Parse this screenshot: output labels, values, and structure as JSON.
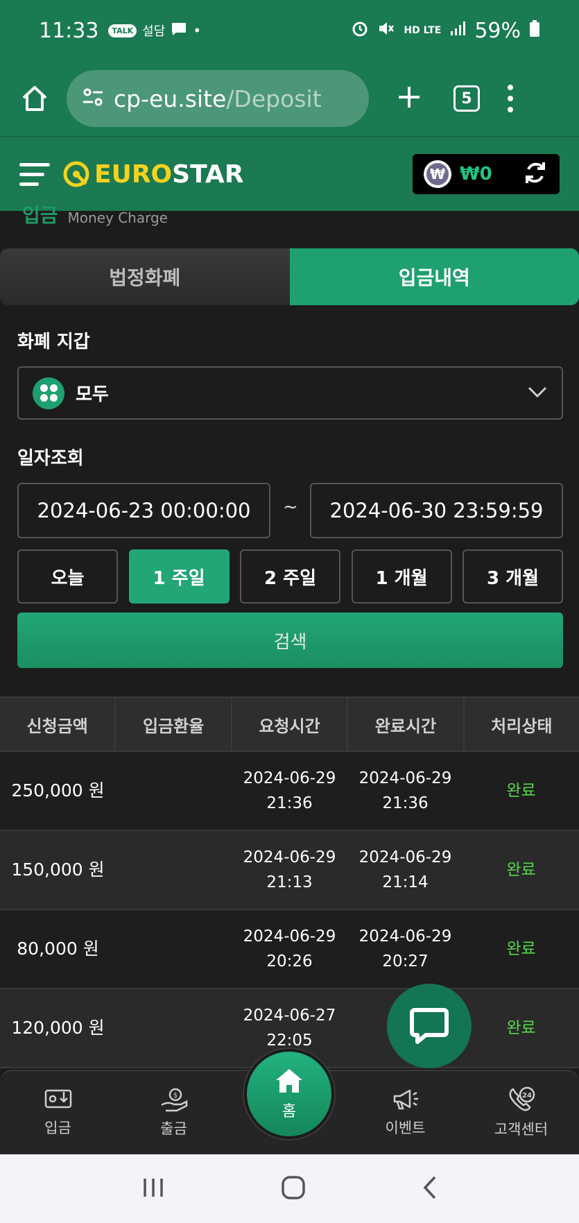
{
  "status_bar": {
    "time": "11:33",
    "notif_talk": "TALK",
    "notif_text": "설담",
    "signal": "HD LTE",
    "battery": "59%"
  },
  "browser": {
    "url_host": "cp-eu.site",
    "url_path": "/Deposit",
    "tab_count": "5"
  },
  "header": {
    "logo_euro": "EURO",
    "logo_star": "STAR",
    "wallet_symbol": "₩",
    "wallet_amount": "₩0"
  },
  "page": {
    "title_ko": "입금",
    "title_en": "Money Charge"
  },
  "tabs": [
    {
      "label": "법정화폐",
      "active": false
    },
    {
      "label": "입금내역",
      "active": true
    }
  ],
  "filters": {
    "wallet_label": "화폐 지갑",
    "wallet_value": "모두",
    "date_label": "일자조회",
    "date_from": "2024-06-23 00:00:00",
    "date_sep": "~",
    "date_to": "2024-06-30 23:59:59",
    "periods": [
      "오늘",
      "1 주일",
      "2 주일",
      "1 개월",
      "3 개월"
    ],
    "active_period": "1 주일",
    "search_label": "검색"
  },
  "table": {
    "headers": [
      "신청금액",
      "입금환율",
      "요청시간",
      "완료시간",
      "처리상태"
    ],
    "rows": [
      {
        "amount": "250,000 원",
        "rate": "",
        "req_date": "2024-06-29",
        "req_time": "21:36",
        "done_date": "2024-06-29",
        "done_time": "21:36",
        "status": "완료"
      },
      {
        "amount": "150,000 원",
        "rate": "",
        "req_date": "2024-06-29",
        "req_time": "21:13",
        "done_date": "2024-06-29",
        "done_time": "21:14",
        "status": "완료"
      },
      {
        "amount": "80,000 원",
        "rate": "",
        "req_date": "2024-06-29",
        "req_time": "20:26",
        "done_date": "2024-06-29",
        "done_time": "20:27",
        "status": "완료"
      },
      {
        "amount": "120,000 원",
        "rate": "",
        "req_date": "2024-06-27",
        "req_time": "22:05",
        "done_date": "202",
        "done_time": "2",
        "status": "완료"
      }
    ]
  },
  "bottom_nav": {
    "deposit": "입금",
    "withdraw": "출금",
    "home": "홈",
    "event": "이벤트",
    "support": "고객센터",
    "support_badge": "24"
  },
  "colors": {
    "brand_green": "#1a7a52",
    "accent_green": "#1fa071",
    "logo_yellow": "#f5d21c",
    "status_complete": "#56d64a"
  }
}
